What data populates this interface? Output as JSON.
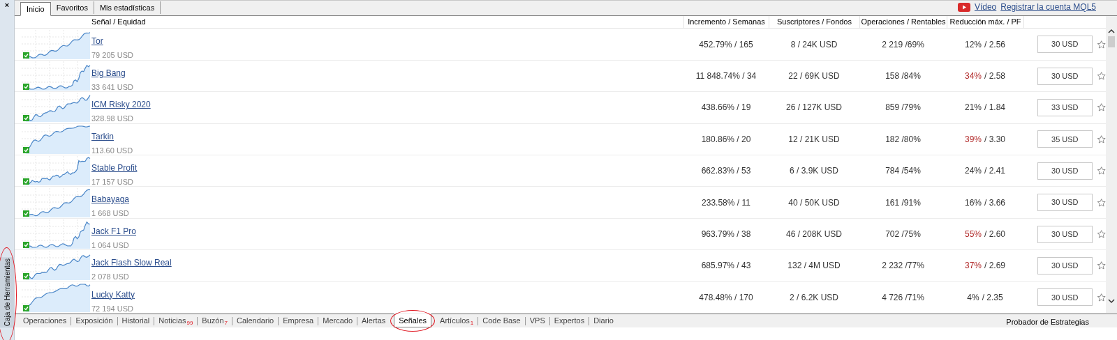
{
  "sidebar": {
    "close": "×",
    "label": "Caja de Herramientas",
    "circled": true
  },
  "top_tabs": [
    {
      "label": "Inicio",
      "selected": true
    },
    {
      "label": "Favoritos",
      "selected": false
    },
    {
      "label": "Mis estadísticas",
      "selected": false
    }
  ],
  "top_links": [
    "Vídeo",
    "Registrar la cuenta MQL5"
  ],
  "table": {
    "columns": [
      "Señal / Equidad",
      "Incremento / Semanas",
      "Suscriptores / Fondos",
      "Operaciones / Rentables",
      "Reducción máx. / PF"
    ],
    "rows": [
      {
        "name": "Tor",
        "equity": "79 205 USD",
        "growth": "452.79% / 165",
        "subscribers": "8 / 24K USD",
        "trades": "2 219 /69%",
        "drawdown": "12%",
        "pf": "/ 2.56",
        "drawdown_alert": false,
        "price": "30 USD"
      },
      {
        "name": "Big Bang",
        "equity": "33 641 USD",
        "growth": "11 848.74% / 34",
        "subscribers": "22 / 69K USD",
        "trades": "158 /84%",
        "drawdown": "34%",
        "pf": "/ 2.58",
        "drawdown_alert": true,
        "price": "30 USD"
      },
      {
        "name": "ICM Risky 2020",
        "equity": "328.98 USD",
        "growth": "438.66% / 19",
        "subscribers": "26 / 127K USD",
        "trades": "859 /79%",
        "drawdown": "21%",
        "pf": "/ 1.84",
        "drawdown_alert": false,
        "price": "33 USD"
      },
      {
        "name": "Tarkin",
        "equity": "113.60 USD",
        "growth": "180.86% / 20",
        "subscribers": "12 / 21K USD",
        "trades": "182 /80%",
        "drawdown": "39%",
        "pf": "/ 3.30",
        "drawdown_alert": true,
        "price": "35 USD"
      },
      {
        "name": "Stable Profit",
        "equity": "17 157 USD",
        "growth": "662.83% / 53",
        "subscribers": "6 / 3.9K USD",
        "trades": "784 /54%",
        "drawdown": "24%",
        "pf": "/ 2.41",
        "drawdown_alert": false,
        "price": "30 USD"
      },
      {
        "name": "Babayaga",
        "equity": "1 668 USD",
        "growth": "233.58% / 11",
        "subscribers": "40 / 50K USD",
        "trades": "161 /91%",
        "drawdown": "16%",
        "pf": "/ 3.66",
        "drawdown_alert": false,
        "price": "30 USD"
      },
      {
        "name": "Jack F1 Pro",
        "equity": "1 064 USD",
        "growth": "963.79% / 38",
        "subscribers": "46 / 208K USD",
        "trades": "702 /75%",
        "drawdown": "55%",
        "pf": "/ 2.60",
        "drawdown_alert": true,
        "price": "30 USD"
      },
      {
        "name": "Jack Flash Slow Real",
        "equity": "2 078 USD",
        "growth": "685.97% / 43",
        "subscribers": "132 / 4M USD",
        "trades": "2 232 /77%",
        "drawdown": "37%",
        "pf": "/ 2.69",
        "drawdown_alert": true,
        "price": "30 USD"
      },
      {
        "name": "Lucky Katty",
        "equity": "72 194 USD",
        "growth": "478.48% / 170",
        "subscribers": "2 / 6.2K USD",
        "trades": "4 726 /71%",
        "drawdown": "4%",
        "pf": "/ 2.35",
        "drawdown_alert": false,
        "price": "30 USD"
      }
    ]
  },
  "bottom_tabs": [
    {
      "label": "Operaciones",
      "selected": false,
      "circled": false
    },
    {
      "label": "Exposición",
      "selected": false,
      "circled": false
    },
    {
      "label": "Historial",
      "selected": false,
      "circled": false
    },
    {
      "label": "Noticias",
      "badge": "99",
      "selected": false,
      "circled": false
    },
    {
      "label": "Buzón",
      "badge": "7",
      "selected": false,
      "circled": false
    },
    {
      "label": "Calendario",
      "selected": false,
      "circled": false
    },
    {
      "label": "Empresa",
      "selected": false,
      "circled": false
    },
    {
      "label": "Mercado",
      "selected": false,
      "circled": false
    },
    {
      "label": "Alertas",
      "selected": false,
      "circled": false
    },
    {
      "label": "Señales",
      "selected": true,
      "circled": true
    },
    {
      "label": "Artículos",
      "badge": "1",
      "selected": false,
      "circled": false
    },
    {
      "label": "Code Base",
      "selected": false,
      "circled": false
    },
    {
      "label": "VPS",
      "selected": false,
      "circled": false
    },
    {
      "label": "Expertos",
      "selected": false,
      "circled": false
    },
    {
      "label": "Diario",
      "selected": false,
      "circled": false
    }
  ],
  "status_right": "Probador de Estrategias"
}
